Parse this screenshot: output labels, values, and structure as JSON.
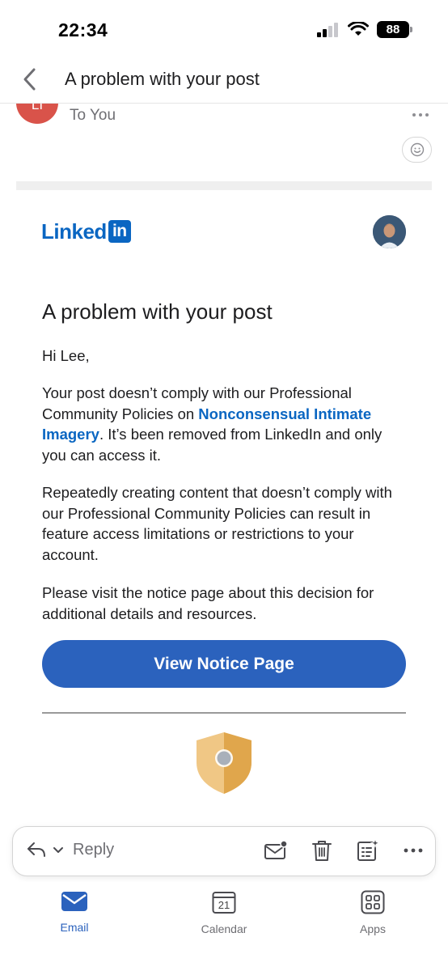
{
  "status_bar": {
    "time": "22:34",
    "battery": "88"
  },
  "header": {
    "title": "A problem with your post"
  },
  "sender": {
    "initials": "LI",
    "recipient_line": "To You"
  },
  "email": {
    "logo_text": "Linked",
    "logo_box": "in",
    "title": "A problem with your post",
    "greeting": "Hi Lee,",
    "p1_before": "Your post doesn’t comply with our Professional Community Policies on ",
    "p1_link": "Nonconsensual Intimate Imagery",
    "p1_after": ". It’s been removed from LinkedIn and only you can access it.",
    "p2": "Repeatedly creating content that doesn’t comply with our Professional Community Policies can result in feature access limitations or restrictions to your account.",
    "p3": "Please visit the notice page about this decision for additional details and resources.",
    "cta": "View Notice Page"
  },
  "action_bar": {
    "reply_label": "Reply"
  },
  "tabs": [
    {
      "label": "Email",
      "icon": "mail-icon",
      "active": true
    },
    {
      "label": "Calendar",
      "icon": "calendar-icon",
      "day": "21"
    },
    {
      "label": "Apps",
      "icon": "apps-icon"
    }
  ],
  "colors": {
    "linkedin_blue": "#0a66c2",
    "cta_blue": "#2b62bd",
    "avatar_red": "#d9534a",
    "shield_gold": "#e3a94f"
  }
}
